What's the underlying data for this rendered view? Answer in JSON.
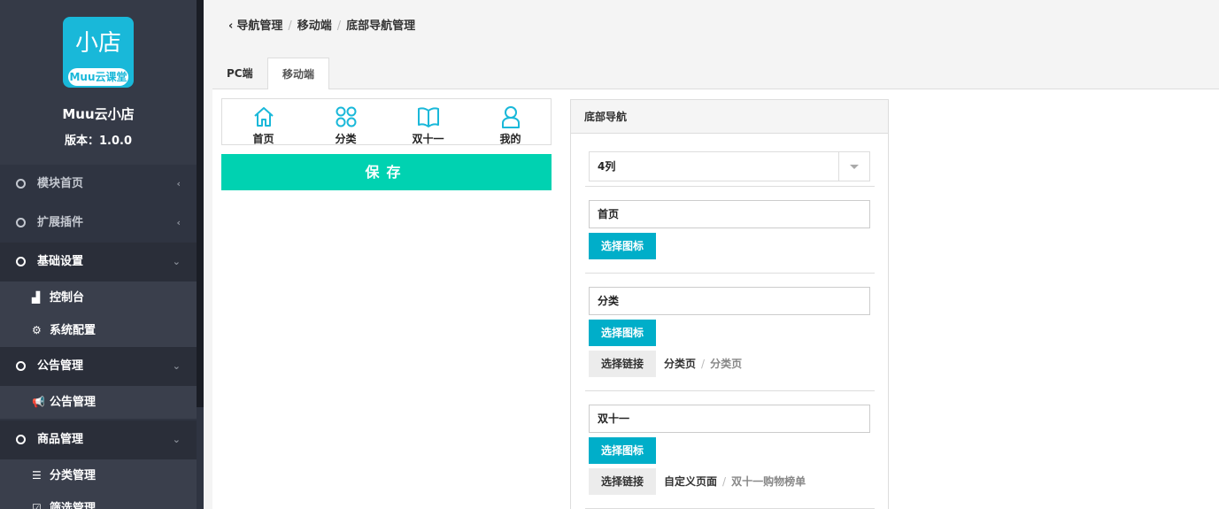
{
  "sidebar": {
    "logo_main": "小店",
    "logo_sub": "Muu云课堂",
    "app_name": "Muu云小店",
    "version": "版本：1.0.0",
    "menu": [
      {
        "label": "模块首页",
        "chevron": "‹"
      },
      {
        "label": "扩展插件",
        "chevron": "‹"
      },
      {
        "label": "基础设置",
        "chevron": "⌄"
      },
      {
        "label": "公告管理",
        "chevron": "⌄"
      },
      {
        "label": "商品管理",
        "chevron": "⌄"
      }
    ],
    "sub": [
      {
        "label": "控制台",
        "icon": "area-chart-icon",
        "glyph": "▟"
      },
      {
        "label": "系统配置",
        "icon": "cogs-icon",
        "glyph": "⚙"
      },
      {
        "label": "公告管理",
        "icon": "bullhorn-icon",
        "glyph": "📢"
      },
      {
        "label": "分类管理",
        "icon": "list-icon",
        "glyph": "☰"
      },
      {
        "label": "筛选管理",
        "icon": "check-square-icon",
        "glyph": "☑"
      }
    ]
  },
  "breadcrumb": {
    "back": "‹",
    "items": [
      "导航管理",
      "移动端",
      "底部导航管理"
    ],
    "sep": "/"
  },
  "tabs": [
    {
      "label": "PC端"
    },
    {
      "label": "移动端"
    }
  ],
  "preview": {
    "items": [
      {
        "label": "首页"
      },
      {
        "label": "分类"
      },
      {
        "label": "双十一"
      },
      {
        "label": "我的"
      }
    ],
    "save_label": "保存"
  },
  "panel": {
    "title": "底部导航",
    "columns_value": "4列",
    "items": [
      {
        "name": "首页",
        "icon_btn": "选择图标"
      },
      {
        "name": "分类",
        "icon_btn": "选择图标",
        "link_btn": "选择链接",
        "link_main": "分类页",
        "link_sub": "分类页"
      },
      {
        "name": "双十一",
        "icon_btn": "选择图标",
        "link_btn": "选择链接",
        "link_main": "自定义页面",
        "link_sub": "双十一购物榜单"
      }
    ],
    "sep": "/"
  },
  "colors": {
    "sidebar_bg": "#2f3441",
    "logo_bg": "#19b8d9",
    "save_btn": "#00d2b1",
    "icon_btn": "#00aec9",
    "nav_icon": "#19b8d9"
  }
}
